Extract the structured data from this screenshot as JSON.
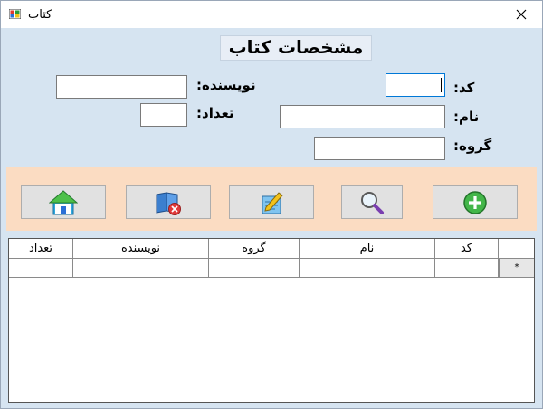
{
  "window": {
    "title": "کتاب",
    "close_glyph": "✕"
  },
  "form": {
    "heading": "مشخصات کتاب",
    "labels": {
      "code": "کد:",
      "name": "نام:",
      "group": "گروه:",
      "author": "نویسنده:",
      "count": "تعداد:"
    },
    "values": {
      "code": "",
      "name": "",
      "group": "",
      "author": "",
      "count": ""
    }
  },
  "toolbar": {
    "buttons": [
      "add-icon",
      "search-icon",
      "edit-icon",
      "delete-icon",
      "home-icon"
    ]
  },
  "grid": {
    "columns": [
      "کد",
      "نام",
      "گروه",
      "نویسنده",
      "تعداد"
    ],
    "new_row_marker": "*"
  },
  "colors": {
    "form_background": "#d6e4f1",
    "toolbar_background": "#fbdcc2",
    "button_face": "#e1e1e1",
    "focus_border": "#0078d7"
  }
}
